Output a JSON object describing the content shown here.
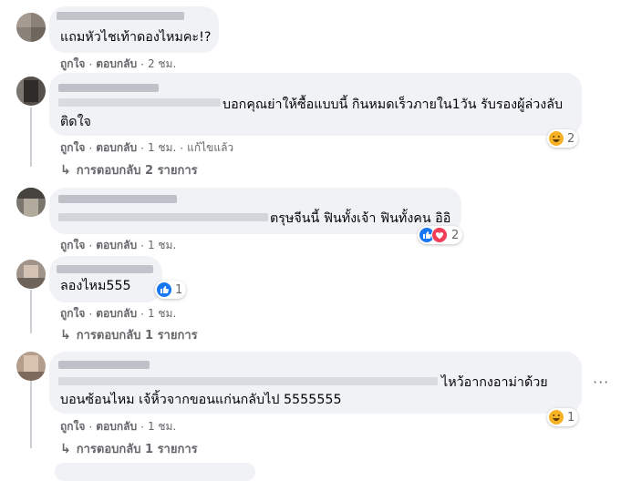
{
  "comments": [
    {
      "text": [
        "แถมหัวไชเท้าดองไหมคะ!?"
      ],
      "actions": {
        "like": "ถูกใจ",
        "reply": "ตอบกลับ",
        "time": "2 ชม."
      }
    },
    {
      "text": [
        "บอกคุณย่าให้ซื้อแบบนี้ กินหมดเร็วภายใน1วัน รับรองผู้ล่วงลับ",
        "ติดใจ"
      ],
      "actions": {
        "like": "ถูกใจ",
        "reply": "ตอบกลับ",
        "time": "1 ชม.",
        "edited": "แก้ไขแล้ว"
      },
      "reaction": {
        "icons": [
          "haha-emoji"
        ],
        "count": "2"
      },
      "replies": "การตอบกลับ 2 รายการ"
    },
    {
      "text": [
        "ตรุษจีนนี้ ฟินทั้งเจ้า ฟินทั้งคน อิอิ"
      ],
      "actions": {
        "like": "ถูกใจ",
        "reply": "ตอบกลับ",
        "time": "1 ชม."
      },
      "reaction": {
        "icons": [
          "like",
          "love"
        ],
        "count": "2"
      }
    },
    {
      "text": [
        "ลองไหม555"
      ],
      "actions": {
        "like": "ถูกใจ",
        "reply": "ตอบกลับ",
        "time": "1 ชม."
      },
      "reaction": {
        "icons": [
          "like"
        ],
        "count": "1"
      },
      "replies": "การตอบกลับ 1 รายการ"
    },
    {
      "text": [
        "ไหว้อากงอาม่าด้วย",
        "บอนซ้อนไหม เจ้หิ้วจากขอนแก่นกลับไป 5555555"
      ],
      "actions": {
        "like": "ถูกใจ",
        "reply": "ตอบกลับ",
        "time": "1 ชม."
      },
      "reaction": {
        "icons": [
          "haha-emoji"
        ],
        "count": "1"
      },
      "replies": "การตอบกลับ 1 รายการ",
      "more": "···"
    }
  ],
  "colors": {
    "bubble": "#f0f2f5",
    "meta": "#65676b",
    "like_blue": "#1877f2",
    "love_red": "#f33e58",
    "haha_yellow": "#f7b125"
  }
}
